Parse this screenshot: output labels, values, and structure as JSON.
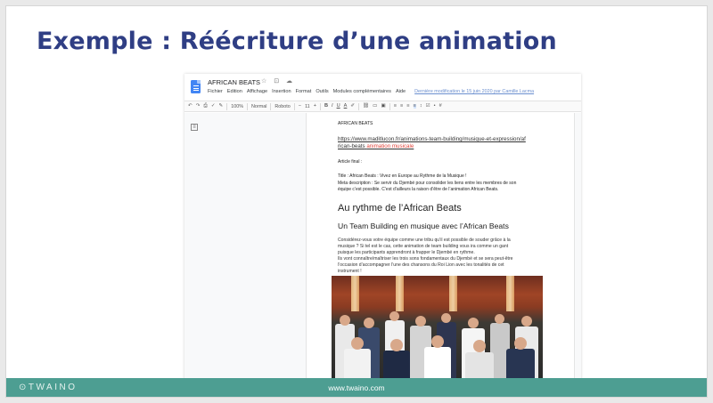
{
  "slide": {
    "title": "Exemple : Réécriture d’une animation"
  },
  "doc": {
    "title": "AFRICAN BEATS",
    "title_icons": "☆ ⊡ ☁",
    "menu": [
      "Fichier",
      "Edition",
      "Affichage",
      "Insertion",
      "Format",
      "Outils",
      "Modules complémentaires",
      "Aide"
    ],
    "last_edit": "Dernière modification le 15 juin 2020 par Camille Lacma"
  },
  "toolbar": {
    "zoom": "100%",
    "style": "Normal",
    "font": "Roboto",
    "size": "11",
    "bold": "B",
    "italic": "I",
    "underline": "U",
    "text_color": "A"
  },
  "page": {
    "heading_caps": "AFRICAN BEATS",
    "url_part1": "https://www.maditlucon.fr/animations-team-building/musique-et-expression/af",
    "url_part2": "rican-beats",
    "url_keyword": "animation musicale",
    "final_article_label": "Article final :",
    "title_line": "Title : African Beats : Vivez en Europe au Rythme de la Musique !",
    "meta_line1": "Meta description : Se servir du Djembé pour consolider les liens entre les membres de son",
    "meta_line2": "équipe c’est possible. C’est d’ailleurs la raison d’être de l’animation African Beats.",
    "h1": "Au rythme de l’African Beats",
    "h2": "Un Team Building en musique avec l’African Beats",
    "body_lines": [
      "Considérez-vous votre équipe comme une tribu qu’il est possible de souder grâce à la",
      "musique ? Si tel est le cas, cette animation de team building vous ira comme un gant",
      "puisque les participants apprendront à frapper le Djembé en rythme.",
      "Ils vont connaître/maîtriser les trois sons fondamentaux du Djembé et se sera peut-être",
      "l’occasion d’accompagner l’une des chansons du Roi Lion avec les tonalités de cet",
      "instrument !"
    ]
  },
  "footer": {
    "logo": "⊙TWAINO",
    "url": "www.twaino.com"
  }
}
